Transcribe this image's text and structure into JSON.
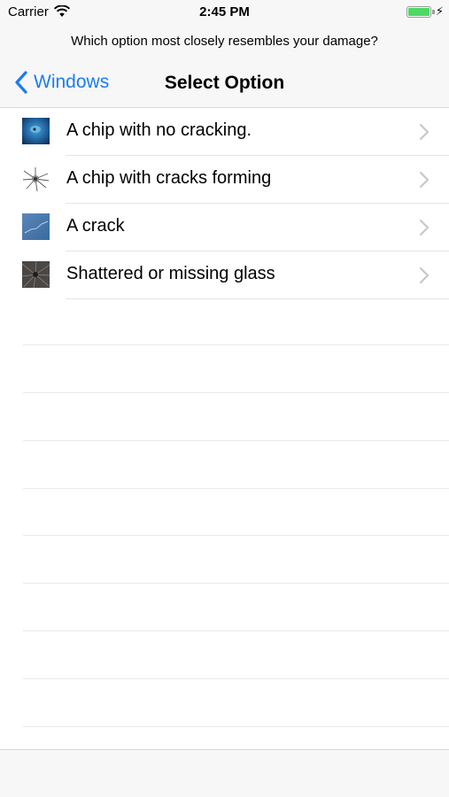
{
  "status_bar": {
    "carrier": "Carrier",
    "time": "2:45 PM",
    "battery_icon": "battery-full-charging-icon",
    "wifi_icon": "wifi-icon"
  },
  "prompt": "Which option most closely resembles your damage?",
  "nav": {
    "back_label": "Windows",
    "title": "Select Option"
  },
  "options": [
    {
      "label": "A chip with no cracking.",
      "thumbnail": "chip-no-crack-image"
    },
    {
      "label": "A chip with cracks forming",
      "thumbnail": "chip-cracks-forming-image"
    },
    {
      "label": "A crack",
      "thumbnail": "crack-image"
    },
    {
      "label": "Shattered or missing glass",
      "thumbnail": "shattered-glass-image"
    }
  ],
  "colors": {
    "accent": "#1a7cf5",
    "battery": "#4cd964",
    "bar_background": "#f7f7f7"
  }
}
